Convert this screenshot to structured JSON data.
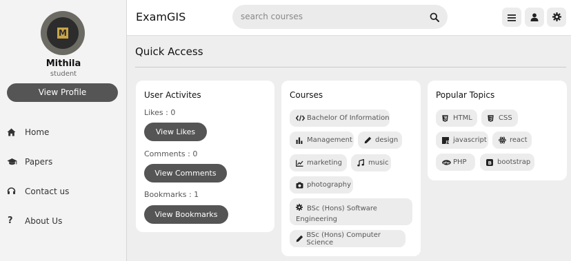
{
  "app": {
    "title": "ExamGIS"
  },
  "search": {
    "placeholder": "search courses"
  },
  "sidebar": {
    "user": {
      "name": "Mithila",
      "role": "student",
      "avatar_letter": "M"
    },
    "view_profile_label": "View Profile",
    "nav": [
      {
        "label": "Home",
        "icon": "home-icon"
      },
      {
        "label": "Papers",
        "icon": "graduation-cap-icon"
      },
      {
        "label": "Contact us",
        "icon": "headset-icon"
      },
      {
        "label": "About Us",
        "icon": "question-mark-icon"
      }
    ]
  },
  "header_buttons": [
    "menu-icon",
    "user-icon",
    "gear-icon"
  ],
  "main": {
    "title": "Quick Access",
    "user_activities": {
      "title": "User Activites",
      "likes_label": "Likes : 0",
      "likes_button": "View Likes",
      "comments_label": "Comments : 0",
      "comments_button": "View Comments",
      "bookmarks_label": "Bookmarks : 1",
      "bookmarks_button": "View Bookmarks"
    },
    "courses": {
      "title": "Courses",
      "items": [
        {
          "label": "Bachelor Of Information",
          "icon": "code-icon"
        },
        {
          "label": "Management",
          "icon": "bar-chart-icon"
        },
        {
          "label": "design",
          "icon": "pen-icon"
        },
        {
          "label": "marketing",
          "icon": "line-chart-icon"
        },
        {
          "label": "music",
          "icon": "music-note-icon"
        },
        {
          "label": "photography",
          "icon": "camera-icon"
        },
        {
          "label": "BSc (Hons) Software Engineering",
          "icon": "gear-icon"
        },
        {
          "label": "BSc (Hons) Computer Science",
          "icon": "pen-icon"
        }
      ]
    },
    "popular_topics": {
      "title": "Popular Topics",
      "items": [
        {
          "label": "HTML",
          "icon": "html5-icon"
        },
        {
          "label": "CSS",
          "icon": "css3-icon"
        },
        {
          "label": "javascript",
          "icon": "js-icon"
        },
        {
          "label": "react",
          "icon": "react-icon"
        },
        {
          "label": "PHP",
          "icon": "php-icon"
        },
        {
          "label": "bootstrap",
          "icon": "bootstrap-icon"
        }
      ]
    }
  },
  "colors": {
    "dark_button": "#555555",
    "background": "#eeeeee",
    "card": "#ffffff",
    "chip": "#ececec"
  }
}
